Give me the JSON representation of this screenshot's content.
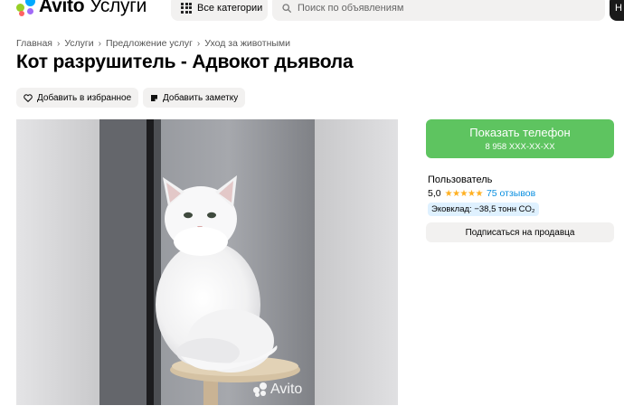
{
  "header": {
    "logo_text": "Avito",
    "logo_sub": "Услуги",
    "categories_label": "Все категории",
    "search_placeholder": "Поиск по объявлениям",
    "right_button_label": "Н"
  },
  "breadcrumb": [
    "Главная",
    "Услуги",
    "Предложение услуг",
    "Уход за животными"
  ],
  "listing": {
    "title": "Кот разрушитель - Адвокот дьявола",
    "add_favorite_label": "Добавить в избранное",
    "add_note_label": "Добавить заметку",
    "photo_watermark": "Avito"
  },
  "sidebar": {
    "phone_button_label": "Показать телефон",
    "phone_number": "8 958 XXX-XX-XX",
    "seller_type": "Пользователь",
    "rating_value": "5,0",
    "stars": "★★★★★",
    "reviews_label": "75 отзывов",
    "eco_label": "Эковклад: −38,5 тонн CO₂",
    "subscribe_label": "Подписаться на продавца"
  },
  "colors": {
    "accent_green": "#5ec460",
    "link_blue": "#0a8fe0",
    "star_yellow": "#ffb021",
    "button_bg": "#f2f1f0"
  }
}
